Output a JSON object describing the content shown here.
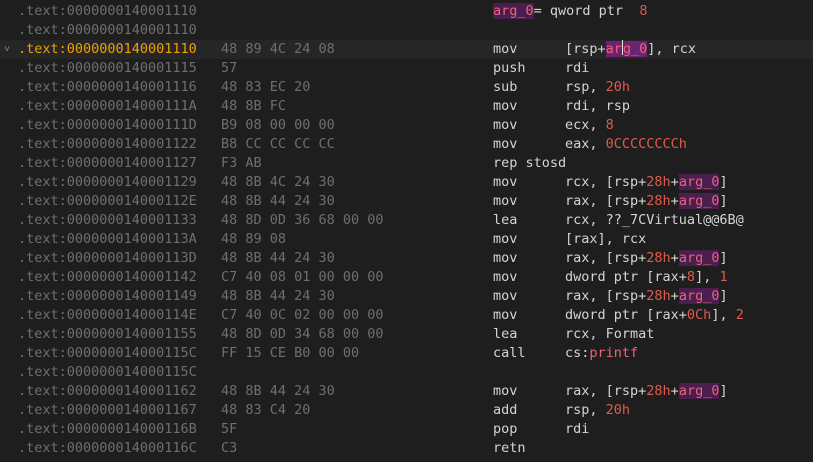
{
  "colors": {
    "background": "#1e1e1e",
    "address": "#6f6f6f",
    "current_address": "#f0a000",
    "variable": "#f06078",
    "variable_bg": "#4a1e4e",
    "number": "#e05a4a",
    "text": "#d4d4d4"
  },
  "icons": {
    "current_line": "chevron-down-icon"
  },
  "rows": [
    {
      "addr": ".text:0000000140001110",
      "decl": {
        "name": "arg_0",
        "eq": "= qword ptr",
        "value": "8"
      }
    },
    {
      "addr": ".text:0000000140001110"
    },
    {
      "addr": ".text:0000000140001110",
      "current": true,
      "bytes": "48 89 4C 24 08",
      "mnem": "mov",
      "ops": [
        {
          "t": "[rsp+"
        },
        {
          "t": "ar",
          "c": "var-hl"
        },
        {
          "caret": true
        },
        {
          "t": "g_0",
          "c": "var-hl"
        },
        {
          "t": "], rcx"
        }
      ]
    },
    {
      "addr": ".text:0000000140001115",
      "bytes": "57",
      "mnem": "push",
      "ops": [
        {
          "t": "rdi"
        }
      ]
    },
    {
      "addr": ".text:0000000140001116",
      "bytes": "48 83 EC 20",
      "mnem": "sub",
      "ops": [
        {
          "t": "rsp, "
        },
        {
          "t": "20h",
          "c": "num"
        }
      ]
    },
    {
      "addr": ".text:000000014000111A",
      "bytes": "48 8B FC",
      "mnem": "mov",
      "ops": [
        {
          "t": "rdi, rsp"
        }
      ]
    },
    {
      "addr": ".text:000000014000111D",
      "bytes": "B9 08 00 00 00",
      "mnem": "mov",
      "ops": [
        {
          "t": "ecx, "
        },
        {
          "t": "8",
          "c": "num"
        }
      ]
    },
    {
      "addr": ".text:0000000140001122",
      "bytes": "B8 CC CC CC CC",
      "mnem": "mov",
      "ops": [
        {
          "t": "eax, "
        },
        {
          "t": "0CCCCCCCCh",
          "c": "num"
        }
      ]
    },
    {
      "addr": ".text:0000000140001127",
      "bytes": "F3 AB",
      "mnem": "rep stosd",
      "ops": []
    },
    {
      "addr": ".text:0000000140001129",
      "bytes": "48 8B 4C 24 30",
      "mnem": "mov",
      "ops": [
        {
          "t": "rcx, [rsp+"
        },
        {
          "t": "28h",
          "c": "num"
        },
        {
          "t": "+"
        },
        {
          "t": "arg_0",
          "c": "var"
        },
        {
          "t": "]"
        }
      ]
    },
    {
      "addr": ".text:000000014000112E",
      "bytes": "48 8B 44 24 30",
      "mnem": "mov",
      "ops": [
        {
          "t": "rax, [rsp+"
        },
        {
          "t": "28h",
          "c": "num"
        },
        {
          "t": "+"
        },
        {
          "t": "arg_0",
          "c": "var"
        },
        {
          "t": "]"
        }
      ]
    },
    {
      "addr": ".text:0000000140001133",
      "bytes": "48 8D 0D 36 68 00 00",
      "mnem": "lea",
      "ops": [
        {
          "t": "rcx, ??_7CVirtual@@6B@"
        }
      ]
    },
    {
      "addr": ".text:000000014000113A",
      "bytes": "48 89 08",
      "mnem": "mov",
      "ops": [
        {
          "t": "[rax], rcx"
        }
      ]
    },
    {
      "addr": ".text:000000014000113D",
      "bytes": "48 8B 44 24 30",
      "mnem": "mov",
      "ops": [
        {
          "t": "rax, [rsp+"
        },
        {
          "t": "28h",
          "c": "num"
        },
        {
          "t": "+"
        },
        {
          "t": "arg_0",
          "c": "var"
        },
        {
          "t": "]"
        }
      ]
    },
    {
      "addr": ".text:0000000140001142",
      "bytes": "C7 40 08 01 00 00 00",
      "mnem": "mov",
      "ops": [
        {
          "t": "dword ptr [rax+"
        },
        {
          "t": "8",
          "c": "num"
        },
        {
          "t": "], "
        },
        {
          "t": "1",
          "c": "num"
        }
      ]
    },
    {
      "addr": ".text:0000000140001149",
      "bytes": "48 8B 44 24 30",
      "mnem": "mov",
      "ops": [
        {
          "t": "rax, [rsp+"
        },
        {
          "t": "28h",
          "c": "num"
        },
        {
          "t": "+"
        },
        {
          "t": "arg_0",
          "c": "var"
        },
        {
          "t": "]"
        }
      ]
    },
    {
      "addr": ".text:000000014000114E",
      "bytes": "C7 40 0C 02 00 00 00",
      "mnem": "mov",
      "ops": [
        {
          "t": "dword ptr [rax+"
        },
        {
          "t": "0Ch",
          "c": "num"
        },
        {
          "t": "], "
        },
        {
          "t": "2",
          "c": "num"
        }
      ]
    },
    {
      "addr": ".text:0000000140001155",
      "bytes": "48 8D 0D 34 68 00 00",
      "mnem": "lea",
      "ops": [
        {
          "t": "rcx, Format"
        }
      ]
    },
    {
      "addr": ".text:000000014000115C",
      "bytes": "FF 15 CE B0 00 00",
      "mnem": "call",
      "ops": [
        {
          "t": "cs:"
        },
        {
          "t": "printf",
          "c": "fn"
        }
      ]
    },
    {
      "addr": ".text:000000014000115C"
    },
    {
      "addr": ".text:0000000140001162",
      "bytes": "48 8B 44 24 30",
      "mnem": "mov",
      "ops": [
        {
          "t": "rax, [rsp+"
        },
        {
          "t": "28h",
          "c": "num"
        },
        {
          "t": "+"
        },
        {
          "t": "arg_0",
          "c": "var"
        },
        {
          "t": "]"
        }
      ]
    },
    {
      "addr": ".text:0000000140001167",
      "bytes": "48 83 C4 20",
      "mnem": "add",
      "ops": [
        {
          "t": "rsp, "
        },
        {
          "t": "20h",
          "c": "num"
        }
      ]
    },
    {
      "addr": ".text:000000014000116B",
      "bytes": "5F",
      "mnem": "pop",
      "ops": [
        {
          "t": "rdi"
        }
      ]
    },
    {
      "addr": ".text:000000014000116C",
      "bytes": "C3",
      "mnem": "retn",
      "ops": []
    }
  ]
}
